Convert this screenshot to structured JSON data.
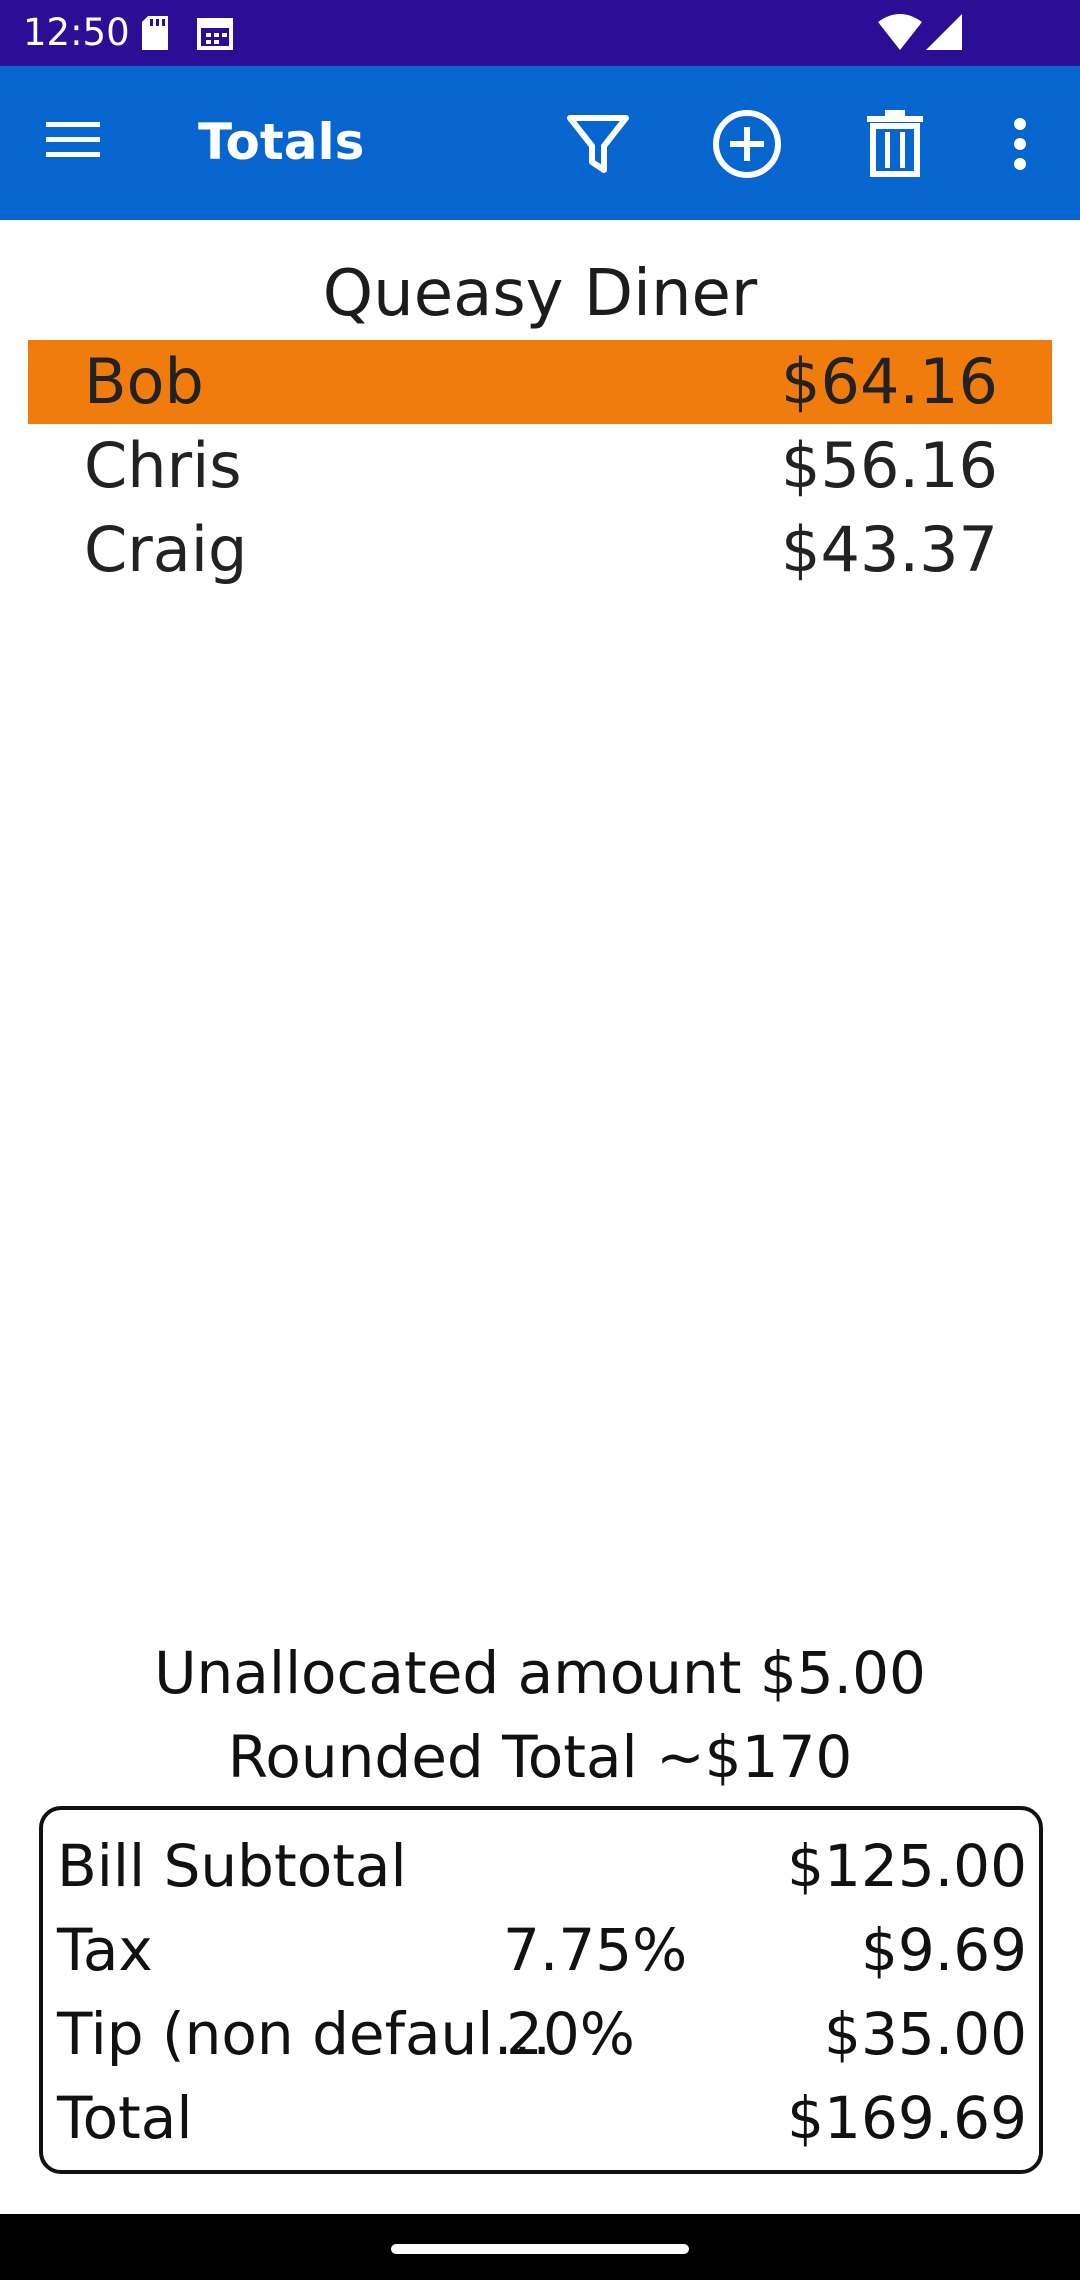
{
  "status_bar": {
    "time": "12:50"
  },
  "app_bar": {
    "title": "Totals",
    "icons": [
      "menu-icon",
      "filter-icon",
      "add-circle-icon",
      "delete-icon",
      "more-vert-icon"
    ]
  },
  "restaurant_name": "Queasy Diner",
  "people": [
    {
      "name": "Bob",
      "amount": "$64.16",
      "selected": true
    },
    {
      "name": "Chris",
      "amount": "$56.16",
      "selected": false
    },
    {
      "name": "Craig",
      "amount": "$43.37",
      "selected": false
    }
  ],
  "summary": {
    "unallocated": "Unallocated amount $5.00",
    "rounded_total": "Rounded Total ~$170"
  },
  "bill": {
    "subtotal_label": "Bill Subtotal",
    "subtotal_value": "$125.00",
    "tax_label": "Tax",
    "tax_percent": "7.75%",
    "tax_value": "$9.69",
    "tip_label": "Tip (non defaul…",
    "tip_percent": "20%",
    "tip_value": "$35.00",
    "total_label": "Total",
    "total_value": "$169.69"
  },
  "colors": {
    "status_bar": "#2c0e96",
    "app_bar": "#0765cf",
    "selected_row": "#f17c0e"
  }
}
